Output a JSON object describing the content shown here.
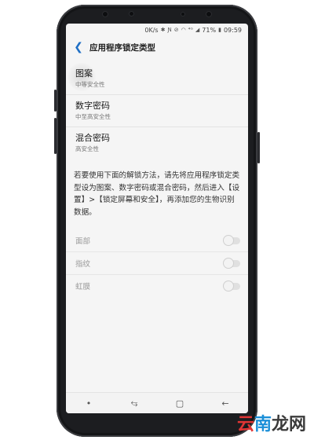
{
  "status": {
    "speed": "0K/s",
    "battery": "71%",
    "time": "09:59",
    "icons": [
      "bluetooth-icon",
      "nfc-icon",
      "mute-icon",
      "wifi-icon",
      "4g-icon",
      "signal-icon",
      "battery-icon"
    ]
  },
  "header": {
    "title": "应用程序锁定类型"
  },
  "options": [
    {
      "title": "图案",
      "subtitle": "中等安全性"
    },
    {
      "title": "数字密码",
      "subtitle": "中至高安全性"
    },
    {
      "title": "混合密码",
      "subtitle": "高安全性"
    }
  ],
  "description": "若要使用下面的解锁方法，请先将应用程序锁定类型设为图案、数字密码或混合密码，然后进入【设置】>【锁定屏幕和安全】，再添加您的生物识别数据。",
  "biometrics": [
    {
      "label": "面部",
      "enabled": false
    },
    {
      "label": "指纹",
      "enabled": false
    },
    {
      "label": "虹膜",
      "enabled": false
    }
  ],
  "navbar": {
    "icons": [
      "dot-icon",
      "recents-icon",
      "home-icon",
      "back-icon"
    ]
  },
  "watermark": {
    "part1": "云",
    "part2": "南",
    "part3": "龙网"
  },
  "colors": {
    "accent": "#1f6fc5",
    "watermark_red": "#e03535",
    "watermark_blue": "#1b8fd8"
  }
}
